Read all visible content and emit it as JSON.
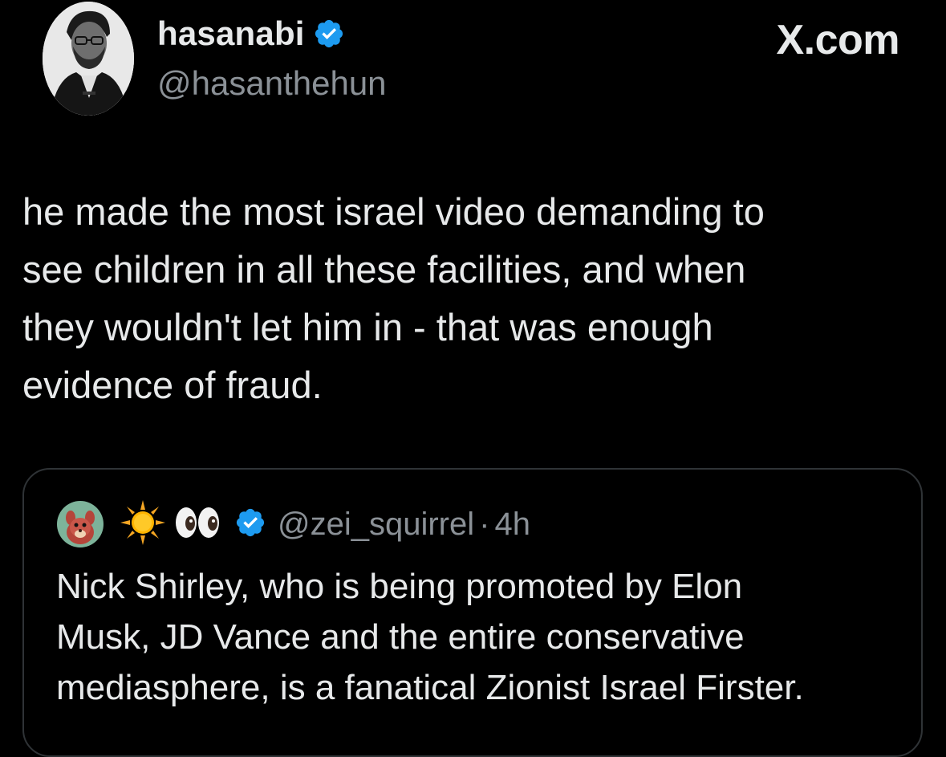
{
  "post": {
    "author": {
      "display_name": "hasanabi",
      "handle": "@hasanthehun",
      "verified": true,
      "avatar_icon": "profile-photo"
    },
    "brand": "X.com",
    "text": "he made the most israel video demanding to\nsee children in all these facilities, and when\nthey wouldn't let him in - that was enough\nevidence of fraud."
  },
  "quoted_post": {
    "author": {
      "avatar_icon": "squirrel-avatar",
      "name_emojis": [
        "sun-emoji",
        "eyes-emoji"
      ],
      "verified": true,
      "handle": "@zei_squirrel"
    },
    "separator": "·",
    "time": "4h",
    "text": "Nick Shirley, who is being promoted by Elon\nMusk, JD Vance and the entire conservative\nmediasphere, is a fanatical Zionist Israel Firster."
  },
  "colors": {
    "background": "#000000",
    "text_primary": "#e7e9ea",
    "text_secondary": "#8b9197",
    "verified_blue": "#1d9bf0",
    "border": "#2f3336"
  }
}
